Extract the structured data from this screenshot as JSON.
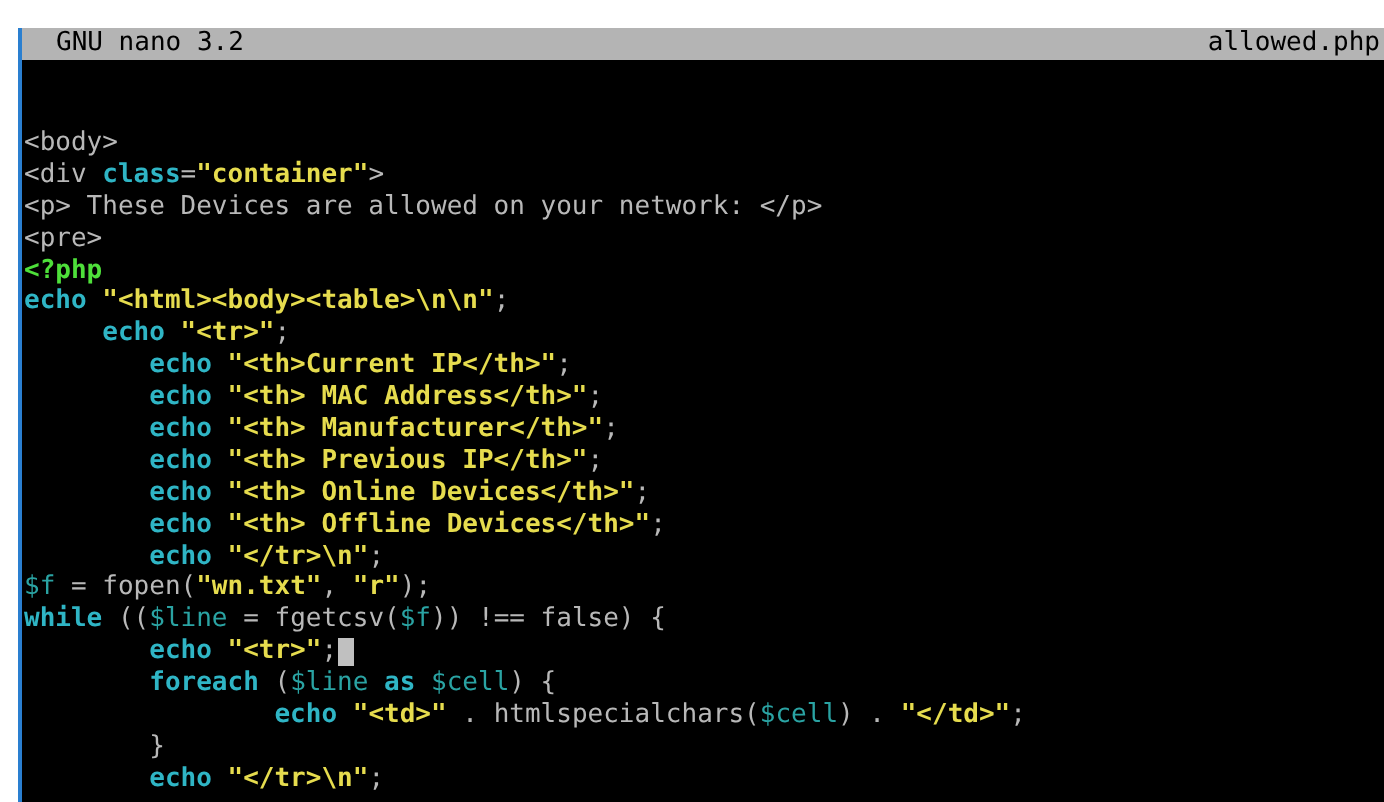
{
  "title_bar": {
    "app": "GNU nano 3.2",
    "file": "allowed.php"
  },
  "lines": [
    {
      "cursor": false,
      "segments": [
        {
          "text": "<body>",
          "kind": "plain"
        }
      ]
    },
    {
      "cursor": false,
      "segments": [
        {
          "text": "<div ",
          "kind": "plain"
        },
        {
          "text": "class",
          "kind": "keyword"
        },
        {
          "text": "=",
          "kind": "plain"
        },
        {
          "text": "\"container\"",
          "kind": "string"
        },
        {
          "text": ">",
          "kind": "plain"
        }
      ]
    },
    {
      "cursor": false,
      "segments": [
        {
          "text": "<p> These Devices are allowed on your network: </p>",
          "kind": "plain"
        }
      ]
    },
    {
      "cursor": false,
      "segments": [
        {
          "text": "<pre>",
          "kind": "plain"
        }
      ]
    },
    {
      "cursor": false,
      "segments": [
        {
          "text": "<?php",
          "kind": "tag"
        }
      ]
    },
    {
      "cursor": false,
      "segments": [
        {
          "text": "echo",
          "kind": "keyword"
        },
        {
          "text": " \"<html><body><table>\\n\\n\"",
          "kind": "string"
        },
        {
          "text": ";",
          "kind": "plain"
        }
      ]
    },
    {
      "cursor": false,
      "segments": [
        {
          "text": "     echo",
          "kind": "keyword"
        },
        {
          "text": " \"<tr>\"",
          "kind": "string"
        },
        {
          "text": ";",
          "kind": "plain"
        }
      ]
    },
    {
      "cursor": false,
      "segments": [
        {
          "text": "        echo",
          "kind": "keyword"
        },
        {
          "text": " \"<th>Current IP</th>\"",
          "kind": "string"
        },
        {
          "text": ";",
          "kind": "plain"
        }
      ]
    },
    {
      "cursor": false,
      "segments": [
        {
          "text": "        echo",
          "kind": "keyword"
        },
        {
          "text": " \"<th> MAC Address</th>\"",
          "kind": "string"
        },
        {
          "text": ";",
          "kind": "plain"
        }
      ]
    },
    {
      "cursor": false,
      "segments": [
        {
          "text": "        echo",
          "kind": "keyword"
        },
        {
          "text": " \"<th> Manufacturer</th>\"",
          "kind": "string"
        },
        {
          "text": ";",
          "kind": "plain"
        }
      ]
    },
    {
      "cursor": false,
      "segments": [
        {
          "text": "        echo",
          "kind": "keyword"
        },
        {
          "text": " \"<th> Previous IP</th>\"",
          "kind": "string"
        },
        {
          "text": ";",
          "kind": "plain"
        }
      ]
    },
    {
      "cursor": false,
      "segments": [
        {
          "text": "        echo",
          "kind": "keyword"
        },
        {
          "text": " \"<th> Online Devices</th>\"",
          "kind": "string"
        },
        {
          "text": ";",
          "kind": "plain"
        }
      ]
    },
    {
      "cursor": false,
      "segments": [
        {
          "text": "        echo",
          "kind": "keyword"
        },
        {
          "text": " \"<th> Offline Devices</th>\"",
          "kind": "string"
        },
        {
          "text": ";",
          "kind": "plain"
        }
      ]
    },
    {
      "cursor": false,
      "segments": [
        {
          "text": "        echo",
          "kind": "keyword"
        },
        {
          "text": " \"</tr>\\n\"",
          "kind": "string"
        },
        {
          "text": ";",
          "kind": "plain"
        }
      ]
    },
    {
      "cursor": false,
      "segments": [
        {
          "text": "$f",
          "kind": "variable"
        },
        {
          "text": " = fopen(",
          "kind": "plain"
        },
        {
          "text": "\"wn.txt\"",
          "kind": "string"
        },
        {
          "text": ", ",
          "kind": "plain"
        },
        {
          "text": "\"r\"",
          "kind": "string"
        },
        {
          "text": ");",
          "kind": "plain"
        }
      ]
    },
    {
      "cursor": false,
      "segments": [
        {
          "text": "while",
          "kind": "keyword"
        },
        {
          "text": " ((",
          "kind": "plain"
        },
        {
          "text": "$line",
          "kind": "variable"
        },
        {
          "text": " = fgetcsv(",
          "kind": "plain"
        },
        {
          "text": "$f",
          "kind": "variable"
        },
        {
          "text": ")) !== false) {",
          "kind": "plain"
        }
      ]
    },
    {
      "cursor": true,
      "segments": [
        {
          "text": "        echo",
          "kind": "keyword"
        },
        {
          "text": " \"<tr>\"",
          "kind": "string"
        },
        {
          "text": ";",
          "kind": "plain"
        }
      ]
    },
    {
      "cursor": false,
      "segments": [
        {
          "text": "        foreach",
          "kind": "keyword"
        },
        {
          "text": " (",
          "kind": "plain"
        },
        {
          "text": "$line",
          "kind": "variable"
        },
        {
          "text": " as ",
          "kind": "keyword"
        },
        {
          "text": "$cell",
          "kind": "variable"
        },
        {
          "text": ") {",
          "kind": "plain"
        }
      ]
    },
    {
      "cursor": false,
      "segments": [
        {
          "text": "                echo",
          "kind": "keyword"
        },
        {
          "text": " \"<td>\"",
          "kind": "string"
        },
        {
          "text": " . htmlspecialchars(",
          "kind": "plain"
        },
        {
          "text": "$cell",
          "kind": "variable"
        },
        {
          "text": ") . ",
          "kind": "plain"
        },
        {
          "text": "\"</td>\"",
          "kind": "string"
        },
        {
          "text": ";",
          "kind": "plain"
        }
      ]
    },
    {
      "cursor": false,
      "segments": [
        {
          "text": "        }",
          "kind": "plain"
        }
      ]
    },
    {
      "cursor": false,
      "segments": [
        {
          "text": "        echo",
          "kind": "keyword"
        },
        {
          "text": " \"</tr>\\n\"",
          "kind": "string"
        },
        {
          "text": ";",
          "kind": "plain"
        }
      ]
    }
  ]
}
